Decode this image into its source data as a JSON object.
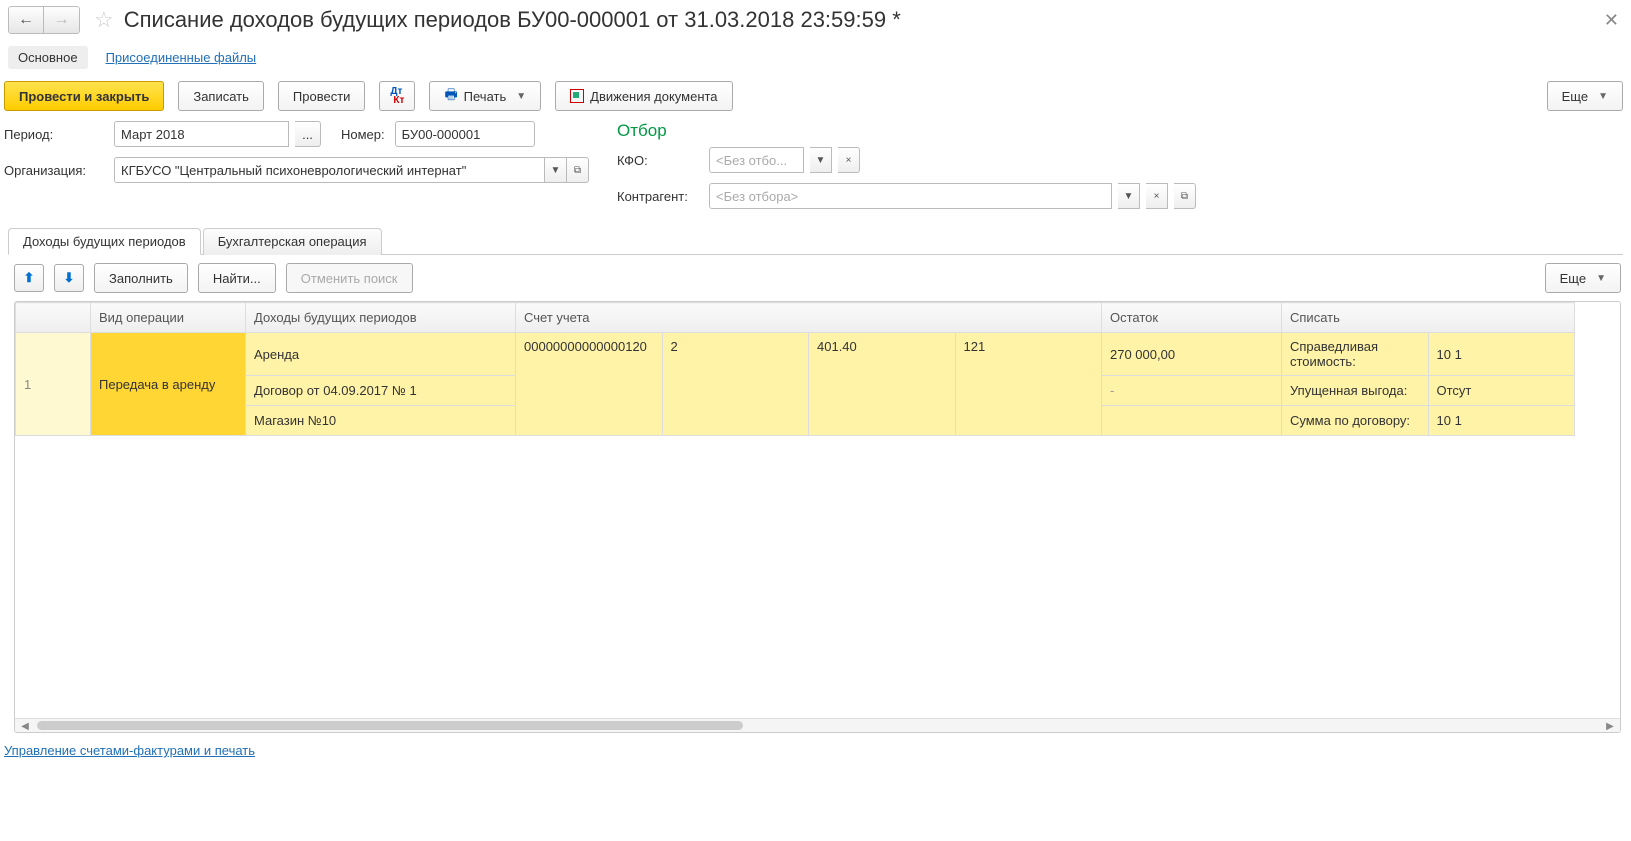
{
  "title": "Списание доходов будущих периодов БУ00-000001 от 31.03.2018 23:59:59 *",
  "topTabs": {
    "main": "Основное",
    "files": "Присоединенные файлы"
  },
  "toolbar": {
    "postClose": "Провести и закрыть",
    "save": "Записать",
    "post": "Провести",
    "print": "Печать",
    "movements": "Движения документа",
    "more": "Еще"
  },
  "form": {
    "periodLabel": "Период:",
    "period": "Март 2018",
    "numberLabel": "Номер:",
    "number": "БУ00-000001",
    "orgLabel": "Организация:",
    "org": "КГБУСО \"Центральный психоневрологический интернат\""
  },
  "filter": {
    "title": "Отбор",
    "kfoLabel": "КФО:",
    "kfoPh": "<Без отбо...",
    "contrLabel": "Контрагент:",
    "contrPh": "<Без отбора>"
  },
  "subtabs": {
    "t1": "Доходы будущих периодов",
    "t2": "Бухгалтерская операция"
  },
  "tabToolbar": {
    "fill": "Заполнить",
    "find": "Найти...",
    "cancelFind": "Отменить поиск",
    "more": "Еще"
  },
  "grid": {
    "headers": {
      "op": "Вид операции",
      "inc": "Доходы будущих периодов",
      "acc": "Счет учета",
      "rest": "Остаток",
      "sp": "Списать"
    },
    "row": {
      "num": "1",
      "op": "Передача в аренду",
      "inc1": "Аренда",
      "inc2": "Договор от 04.09.2017 № 1",
      "inc3": "Магазин №10",
      "acc1": "00000000000000120",
      "acc2": "2",
      "acc3": "401.40",
      "acc4": "121",
      "rest": "270 000,00",
      "sp1l": "Справедливая стоимость:",
      "sp1v": "10 1",
      "sp2l": "Упущенная выгода:",
      "sp2v": "Отсут",
      "sp3l": "Сумма по договору:",
      "sp3v": "10 1"
    }
  },
  "bottomLink": "Управление счетами-фактурами и печать"
}
